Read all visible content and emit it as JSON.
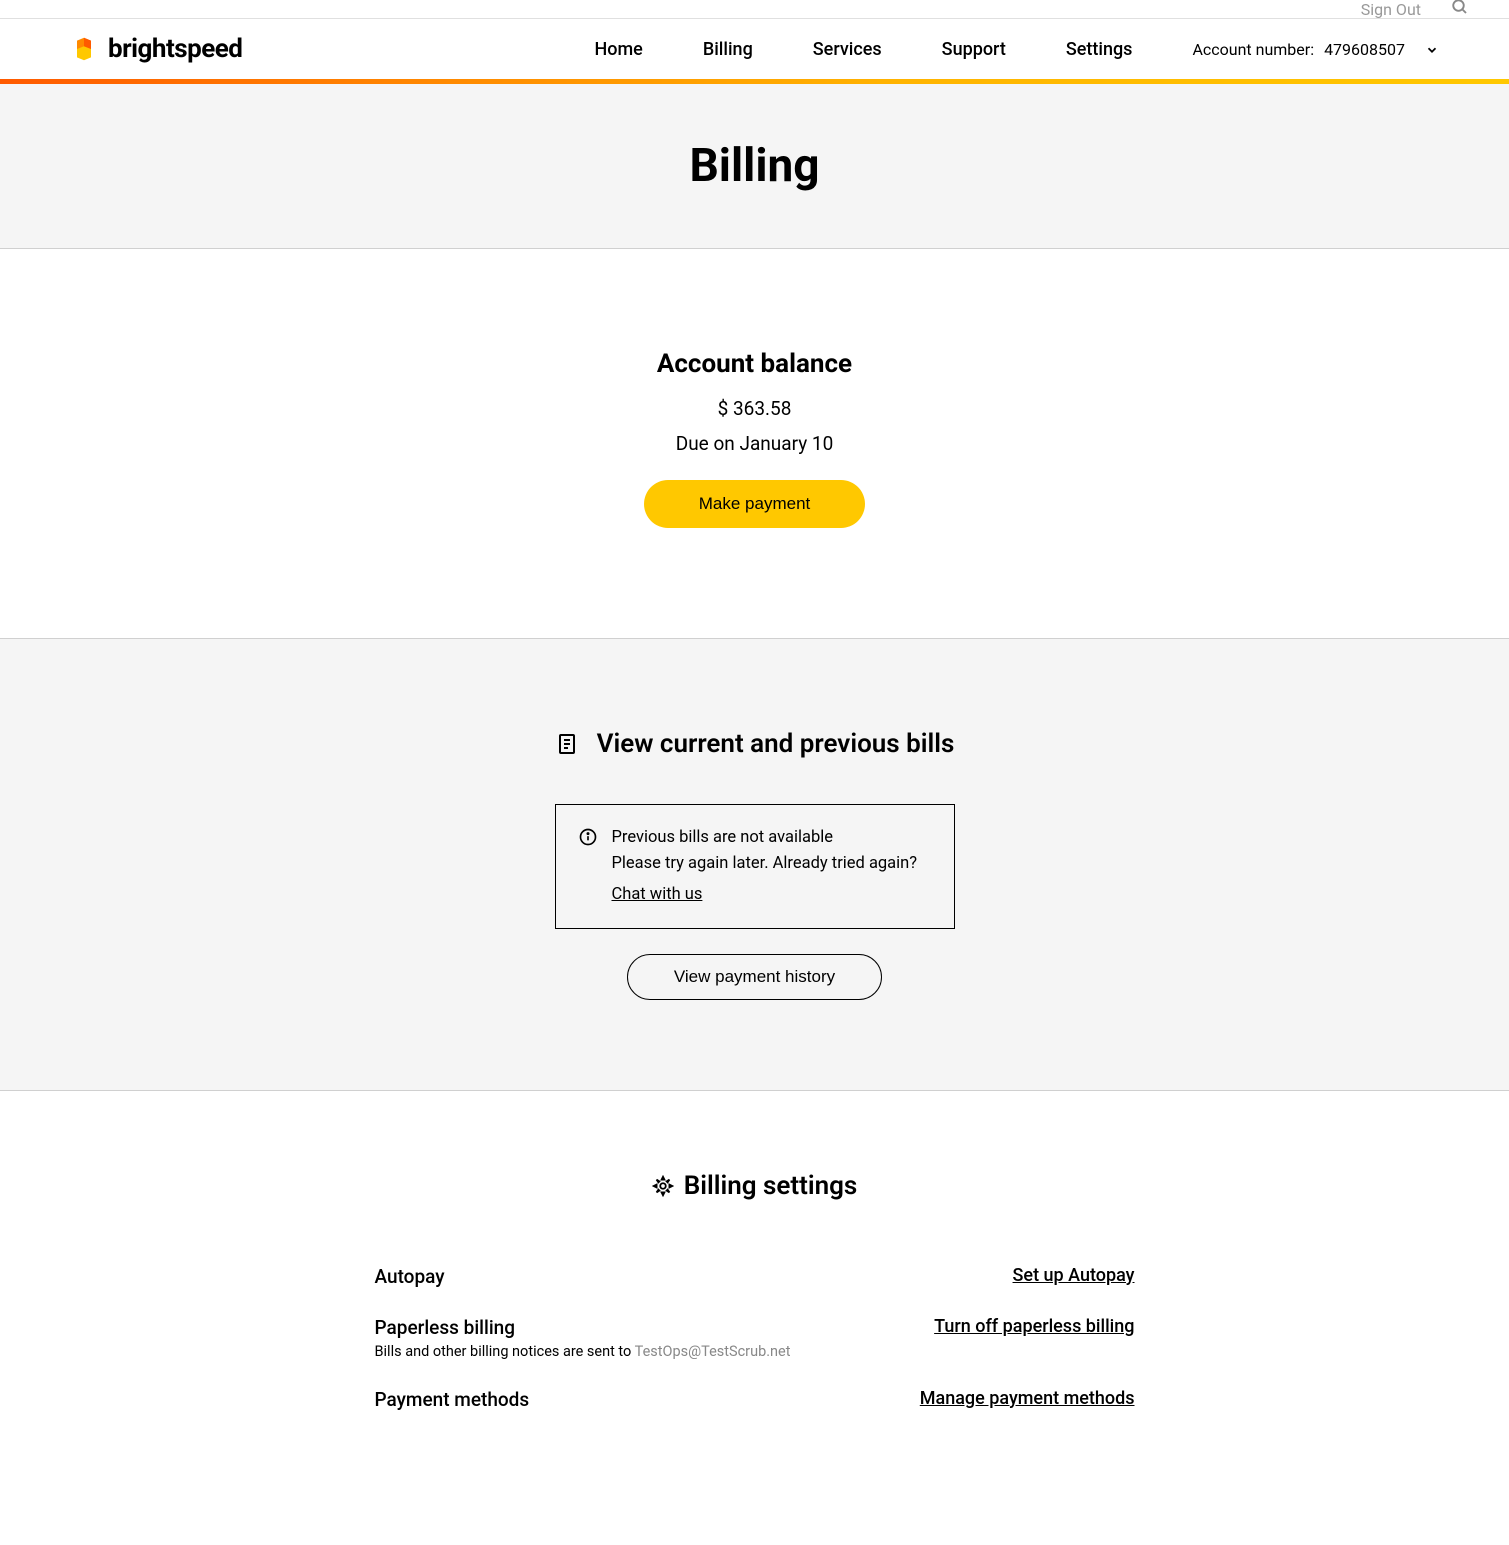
{
  "topbar": {
    "sign_out": "Sign Out"
  },
  "brand": {
    "name": "brightspeed"
  },
  "nav": {
    "items": [
      "Home",
      "Billing",
      "Services",
      "Support",
      "Settings"
    ]
  },
  "account": {
    "label": "Account number:",
    "number": "479608507"
  },
  "page": {
    "title": "Billing"
  },
  "balance": {
    "heading": "Account balance",
    "amount": "$ 363.58",
    "due": "Due on January 10",
    "button": "Make payment"
  },
  "bills": {
    "heading": "View current and previous bills",
    "alert_line1": "Previous bills are not available",
    "alert_line2": "Please try again later. Already tried again?",
    "chat_link": "Chat with us",
    "history_button": "View payment history"
  },
  "settings": {
    "heading": "Billing settings",
    "rows": [
      {
        "label": "Autopay",
        "action": "Set up Autopay"
      },
      {
        "label": "Paperless billing",
        "sub_prefix": "Bills and other billing notices are sent to ",
        "sub_email": "TestOps@TestScrub.net",
        "action": "Turn off paperless billing"
      },
      {
        "label": "Payment methods",
        "action": "Manage payment methods"
      }
    ]
  }
}
